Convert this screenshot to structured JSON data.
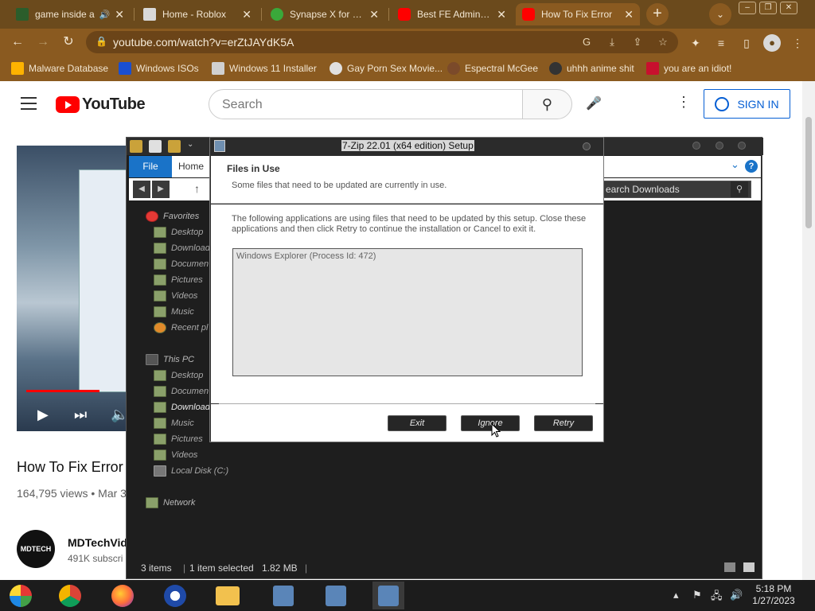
{
  "browser": {
    "tabs": [
      {
        "title": "game inside a",
        "favicon_color": "#2b5d2b"
      },
      {
        "title": "Home - Roblox",
        "favicon_color": "#d9d9d9"
      },
      {
        "title": "Synapse X for Rob",
        "favicon_color": "#3aa83a"
      },
      {
        "title": "Best FE Admin Gu",
        "favicon_color": "#ff0000"
      },
      {
        "title": "How To Fix Error",
        "favicon_color": "#ff0000",
        "active": true
      }
    ],
    "url": "youtube.com/watch?v=erZtJAYdK5A",
    "window_controls": [
      "–",
      "❐",
      "✕"
    ],
    "bookmarks": [
      "Malware Database",
      "Windows ISOs",
      "Windows 11 Installer",
      "Gay Porn Sex Movie...",
      "Espectral McGee",
      "uhhh anime shit",
      "you are an idiot!"
    ]
  },
  "youtube": {
    "logo_text": "YouTube",
    "search_placeholder": "Search",
    "sign_in": "SIGN IN",
    "video_title": "How To Fix Error",
    "views": "164,795 views • Mar 3",
    "channel_name": "MDTechVid",
    "channel_avatar_text": "MDTECH",
    "subscribers": "491K subscri",
    "progress_fraction": 0.72
  },
  "explorer": {
    "ribbon_file": "File",
    "ribbon_home": "Home",
    "search_placeholder": "earch Downloads",
    "nav": {
      "favorites": "Favorites",
      "fav_items": [
        "Desktop",
        "Download",
        "Documen",
        "Pictures",
        "Videos",
        "Music",
        "Recent pl"
      ],
      "this_pc": "This PC",
      "pc_items": [
        "Desktop",
        "Documen",
        "Download",
        "Music",
        "Pictures",
        "Videos",
        "Local Disk (C:)"
      ],
      "network": "Network"
    },
    "status": {
      "items": "3 items",
      "selected": "1 item selected",
      "size": "1.82 MB"
    }
  },
  "dialog": {
    "title": "7-Zip 22.01 (x64 edition) Setup",
    "heading": "Files in Use",
    "subheading": "Some files that need to be updated are currently in use.",
    "description": "The following applications are using files that need to be updated by this setup. Close these applications and then click Retry to continue the installation or Cancel to exit it.",
    "list_items": [
      "Windows Explorer (Process Id: 472)"
    ],
    "buttons": {
      "exit": "Exit",
      "ignore": "Ignore",
      "retry": "Retry"
    }
  },
  "taskbar": {
    "time": "5:18 PM",
    "date": "1/27/2023"
  }
}
